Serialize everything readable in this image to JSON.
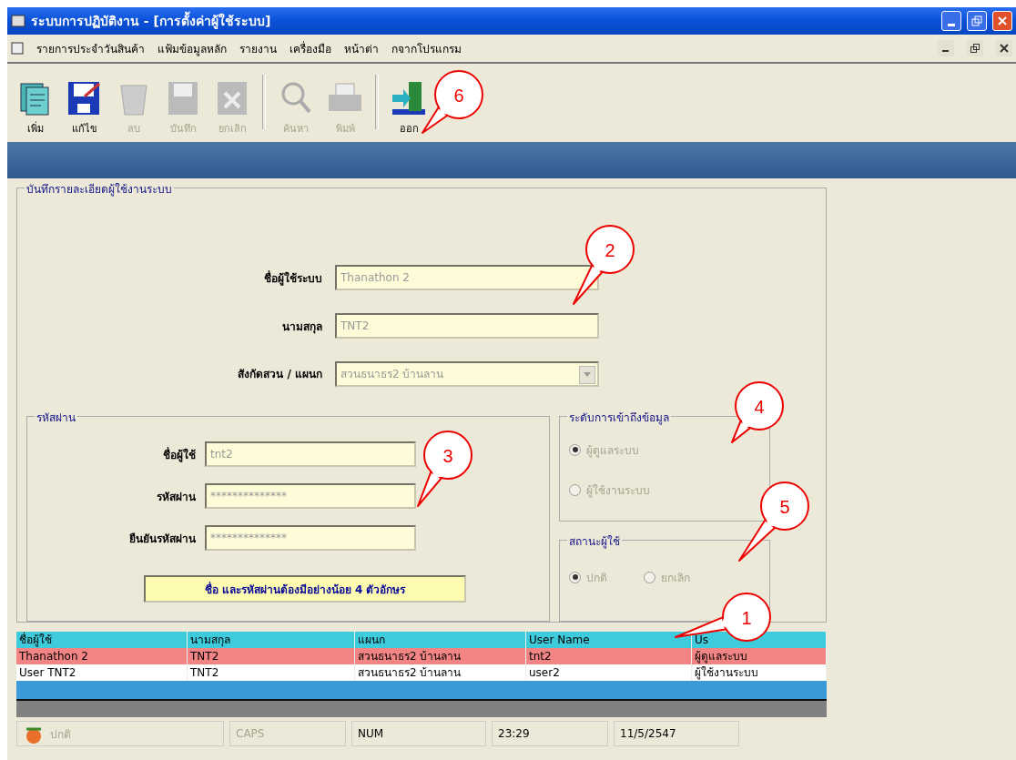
{
  "window": {
    "title": "ระบบการปฏิบัติงาน - [การตั้งค่าผู้ใช้ระบบ]"
  },
  "menu": [
    "รายการประจำวันสินค้า",
    "แฟ้มข้อมูลหลัก",
    "รายงาน",
    "เครื่องมือ",
    "หน้าต่า",
    "กจากโปรแกรม"
  ],
  "toolbar": [
    {
      "label": "เพิ่ม",
      "disabled": false
    },
    {
      "label": "แก้ไข",
      "disabled": false
    },
    {
      "label": "ลบ",
      "disabled": true
    },
    {
      "label": "บันทึก",
      "disabled": true
    },
    {
      "label": "ยกเลิก",
      "disabled": true
    },
    {
      "label": "ค้นหา",
      "disabled": true
    },
    {
      "label": "พิมพ์",
      "disabled": true
    },
    {
      "label": "ออก",
      "disabled": false
    }
  ],
  "form": {
    "title": "บันทึกรายละเอียดผู้ใช้งานระบบ",
    "fields": [
      {
        "label": "ชื่อผู้ใช้ระบบ",
        "value": "Thanathon 2",
        "kind": "text",
        "disabled": true
      },
      {
        "label": "นามสกุล",
        "value": "TNT2",
        "kind": "text",
        "disabled": true
      },
      {
        "label": "สังกัดสวน / แผนก",
        "value": "สวนธนาธร2 บ้านลาน",
        "kind": "select",
        "disabled": true
      }
    ],
    "password": {
      "title": "รหัสผ่าน",
      "fields": [
        {
          "label": "ชื่อผู้ใช้",
          "value": "tnt2",
          "disabled": true
        },
        {
          "label": "รหัสผ่าน",
          "value": "**************",
          "disabled": true
        },
        {
          "label": "ยืนยันรหัสผ่าน",
          "value": "**************",
          "disabled": true
        }
      ],
      "note": "ชื่อ และรหัสผ่านต้องมีอย่างน้อย 4 ตัวอักษร"
    },
    "access": {
      "title": "ระดับการเข้าถึงข้อมูล",
      "options": [
        {
          "label": "ผู้ดูแลระบบ",
          "selected": true,
          "disabled": true
        },
        {
          "label": "ผู้ใช้งานระบบ",
          "selected": false,
          "disabled": true
        }
      ]
    },
    "status": {
      "title": "สถานะผู้ใช้",
      "options": [
        {
          "label": "ปกติ",
          "selected": true,
          "disabled": true
        },
        {
          "label": "ยกเลิก",
          "selected": false,
          "disabled": true
        }
      ]
    }
  },
  "table": {
    "columns": [
      "ชื่อผู้ใช้",
      "นามสกุล",
      "แผนก",
      "User Name",
      "Us"
    ],
    "rows": [
      {
        "cells": [
          "Thanathon 2",
          "TNT2",
          "สวนธนาธร2 บ้านลาน",
          "tnt2",
          "ผู้ดูแลระบบ"
        ],
        "selected": true
      },
      {
        "cells": [
          "User TNT2",
          "TNT2",
          "สวนธนาธร2 บ้านลาน",
          "user2",
          "ผู้ใช้งานระบบ"
        ],
        "selected": false
      }
    ]
  },
  "status_bar": [
    {
      "text": "ปกติ",
      "disabled": true
    },
    {
      "text": "CAPS",
      "disabled": true
    },
    {
      "text": "NUM",
      "disabled": false
    },
    {
      "text": "23:29",
      "disabled": false
    },
    {
      "text": "11/5/2547",
      "disabled": false
    }
  ],
  "callouts": [
    "1",
    "2",
    "3",
    "4",
    "5",
    "6"
  ]
}
